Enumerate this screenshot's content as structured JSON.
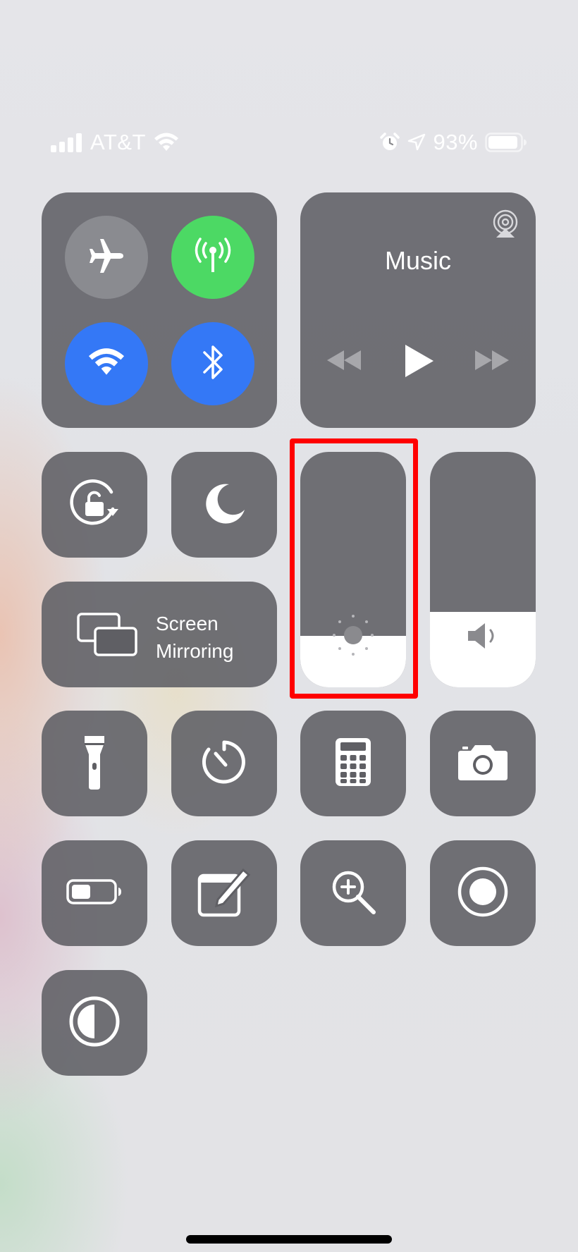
{
  "status_bar": {
    "carrier": "AT&T",
    "battery_percent": "93%",
    "signal_bars": 4,
    "battery_level": 0.93,
    "icons": [
      "signal-bars-icon",
      "wifi-icon",
      "alarm-icon",
      "location-arrow-icon",
      "battery-icon"
    ]
  },
  "connectivity": {
    "airplane_mode": {
      "icon": "airplane-icon",
      "active": false
    },
    "cellular_data": {
      "icon": "antenna-icon",
      "active": true,
      "color": "#4cd964"
    },
    "wifi": {
      "icon": "wifi-icon",
      "active": true,
      "color": "#3478f6"
    },
    "bluetooth": {
      "icon": "bluetooth-icon",
      "active": true,
      "color": "#3478f6"
    }
  },
  "music": {
    "title": "Music",
    "controls": [
      "rewind-icon",
      "play-icon",
      "fast-forward-icon"
    ],
    "airplay_icon": "airplay-audio-icon"
  },
  "toggles": {
    "orientation_lock": "rotation-lock-icon",
    "do_not_disturb": "moon-icon"
  },
  "screen_mirroring": {
    "line1": "Screen",
    "line2": "Mirroring"
  },
  "brightness": {
    "level": 0.22,
    "icon": "sun-icon",
    "highlighted": true,
    "highlight_color": "#ff0000"
  },
  "volume": {
    "level": 0.32,
    "icon": "speaker-icon"
  },
  "shortcuts": [
    "flashlight-icon",
    "timer-icon",
    "calculator-icon",
    "camera-icon",
    "low-power-icon",
    "notes-icon",
    "magnifier-icon",
    "screen-record-icon",
    "dark-mode-icon"
  ]
}
